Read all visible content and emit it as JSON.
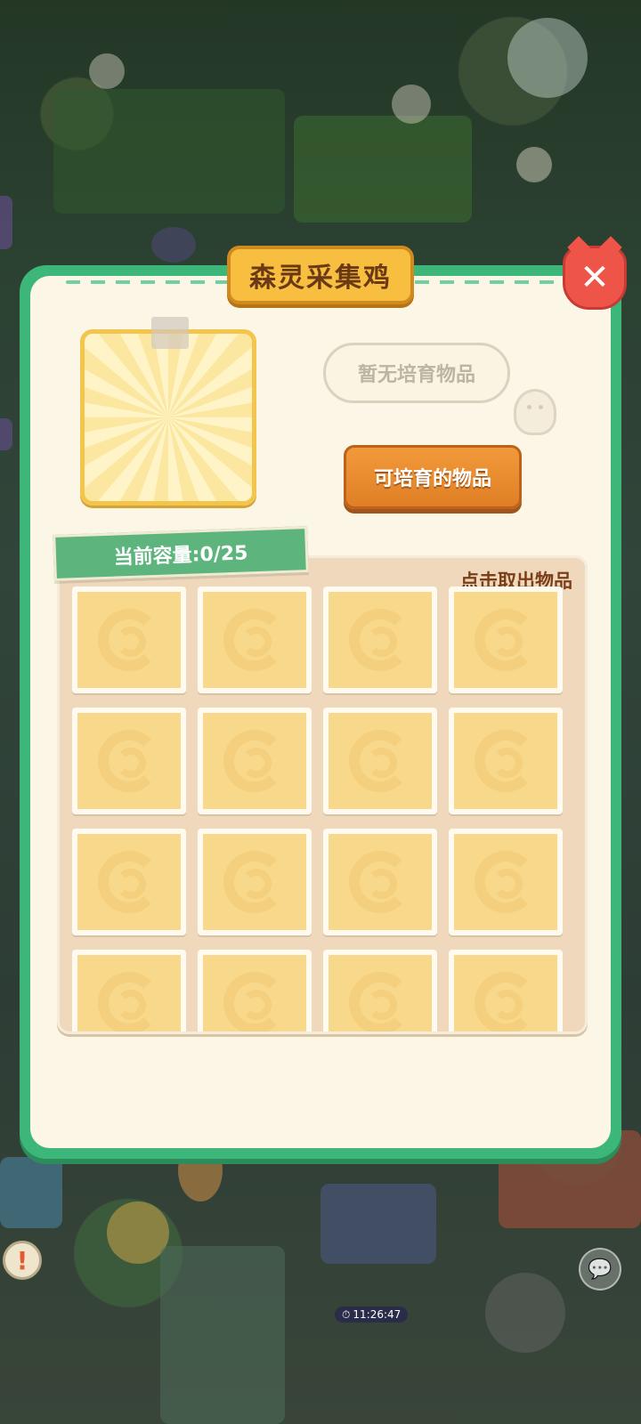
{
  "dialog": {
    "title": "森灵采集鸡",
    "close_icon": "close-x-icon",
    "empty_message": "暂无培育物品",
    "breed_button": "可培育的物品",
    "capacity_label": "当前容量:0/25",
    "take_out_hint": "点击取出物品",
    "slots": [
      {
        "state": "empty"
      },
      {
        "state": "empty"
      },
      {
        "state": "empty"
      },
      {
        "state": "empty"
      },
      {
        "state": "empty"
      },
      {
        "state": "empty"
      },
      {
        "state": "empty"
      },
      {
        "state": "empty"
      },
      {
        "state": "empty"
      },
      {
        "state": "empty"
      },
      {
        "state": "empty"
      },
      {
        "state": "empty"
      },
      {
        "state": "empty"
      },
      {
        "state": "empty"
      },
      {
        "state": "empty"
      },
      {
        "state": "empty"
      }
    ]
  },
  "hud": {
    "timer": "11:26:47",
    "alert_icon": "exclamation-icon",
    "chat_icon": "speech-bubble-icon"
  },
  "colors": {
    "dialog_border": "#3db679",
    "title_plate": "#f7be40",
    "breed_button": "#e8892e",
    "capacity_tag": "#5db57d",
    "close_button": "#ee5548"
  }
}
